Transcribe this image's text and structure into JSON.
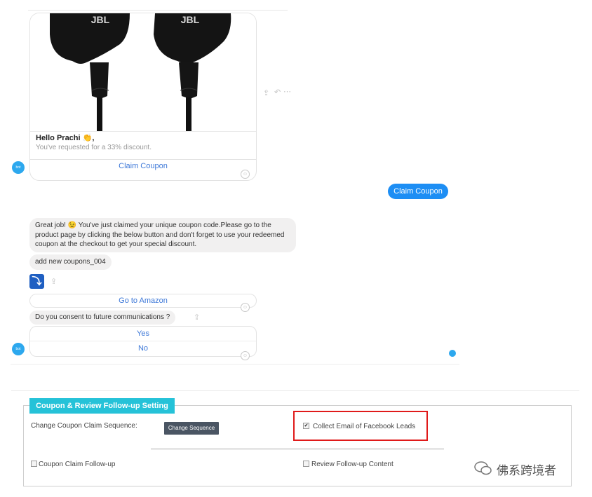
{
  "product_card": {
    "greeting": "Hello Prachi 👏,",
    "subtitle": "You've requested for a 33% discount.",
    "button": "Claim Coupon",
    "brand_text": "JBL"
  },
  "user_reply": "Claim Coupon",
  "bot_message": "Great job! 😉 You've just claimed your unique coupon code.Please go to the product page by clicking the below button and don't forget to use your redeemed coupon at the checkout to get your special discount.",
  "coupon_code_message": "add new coupons_004",
  "go_button": "Go to Amazon",
  "consent_question": "Do you consent to future communications ?",
  "quick_replies": [
    "Yes",
    "No"
  ],
  "settings": {
    "tab_title": "Coupon & Review Follow-up Setting",
    "change_sequence_label": "Change Coupon Claim Sequence:",
    "change_sequence_button": "Change Sequence",
    "collect_email_label": "Collect Email of Facebook Leads",
    "collect_email_checked": true,
    "coupon_followup_label": "Coupon Claim Follow-up",
    "coupon_followup_checked": false,
    "review_followup_label": "Review Follow-up Content",
    "review_followup_checked": false
  },
  "watermark": "佛系跨境者",
  "colors": {
    "messenger_blue": "#1d8ef4",
    "link_blue": "#3d78d8",
    "tab_cyan": "#25c2d8",
    "highlight_red": "#e01a1a"
  }
}
